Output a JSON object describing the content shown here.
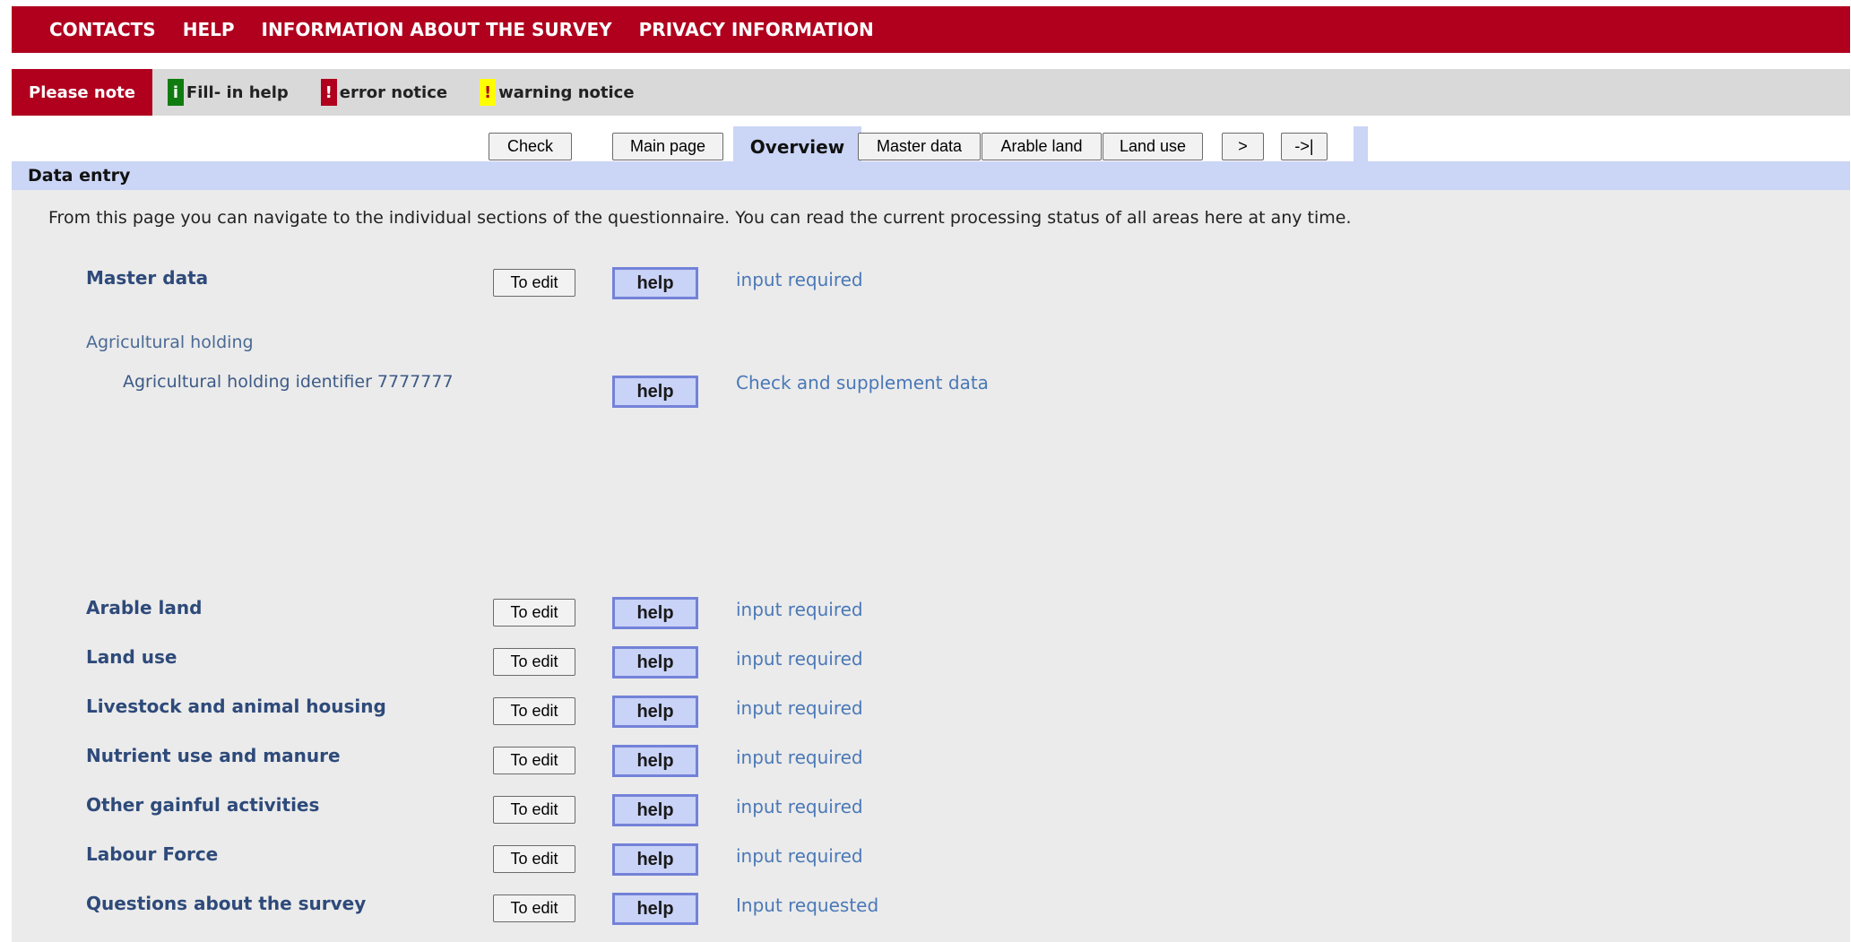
{
  "topnav": {
    "items": [
      "CONTACTS",
      "HELP",
      "INFORMATION ABOUT THE SURVEY",
      "PRIVACY INFORMATION"
    ]
  },
  "notebar": {
    "please_note": "Please note",
    "fill_in_help": {
      "symbol": "i",
      "label": "Fill- in help",
      "color": "#107c10"
    },
    "error_notice": {
      "symbol": "!",
      "label": "error notice",
      "color": "#b0001e"
    },
    "warning_notice": {
      "symbol": "!",
      "label": "warning notice",
      "color": "#ffff00"
    }
  },
  "tabs": {
    "check": "Check",
    "main_page": "Main page",
    "overview": "Overview",
    "master_data": "Master data",
    "arable_land": "Arable land",
    "land_use": "Land use",
    "next": ">",
    "last": "->|"
  },
  "section": {
    "title": "Data entry",
    "intro": "From this page you can navigate to the individual sections of the questionnaire. You can read the current processing status of all areas here at any time."
  },
  "buttons": {
    "edit": "To edit",
    "help": "help"
  },
  "master": {
    "label": "Master data",
    "status": "input required",
    "holding_label": "Agricultural holding",
    "holding_identifier": "Agricultural holding identifier 7777777",
    "holding_status": "Check and supplement data"
  },
  "sections": [
    {
      "label": "Arable land",
      "status": "input required"
    },
    {
      "label": "Land use",
      "status": "input required"
    },
    {
      "label": "Livestock and animal housing",
      "status": "input required"
    },
    {
      "label": "Nutrient use and manure",
      "status": "input required"
    },
    {
      "label": "Other gainful activities",
      "status": "input required"
    },
    {
      "label": "Labour Force",
      "status": "input required"
    },
    {
      "label": "Questions about the survey",
      "status": "Input requested"
    }
  ],
  "colors": {
    "brand_red": "#b0001e",
    "tab_blue": "#cbd5f5",
    "link_blue": "#4a78b7"
  }
}
